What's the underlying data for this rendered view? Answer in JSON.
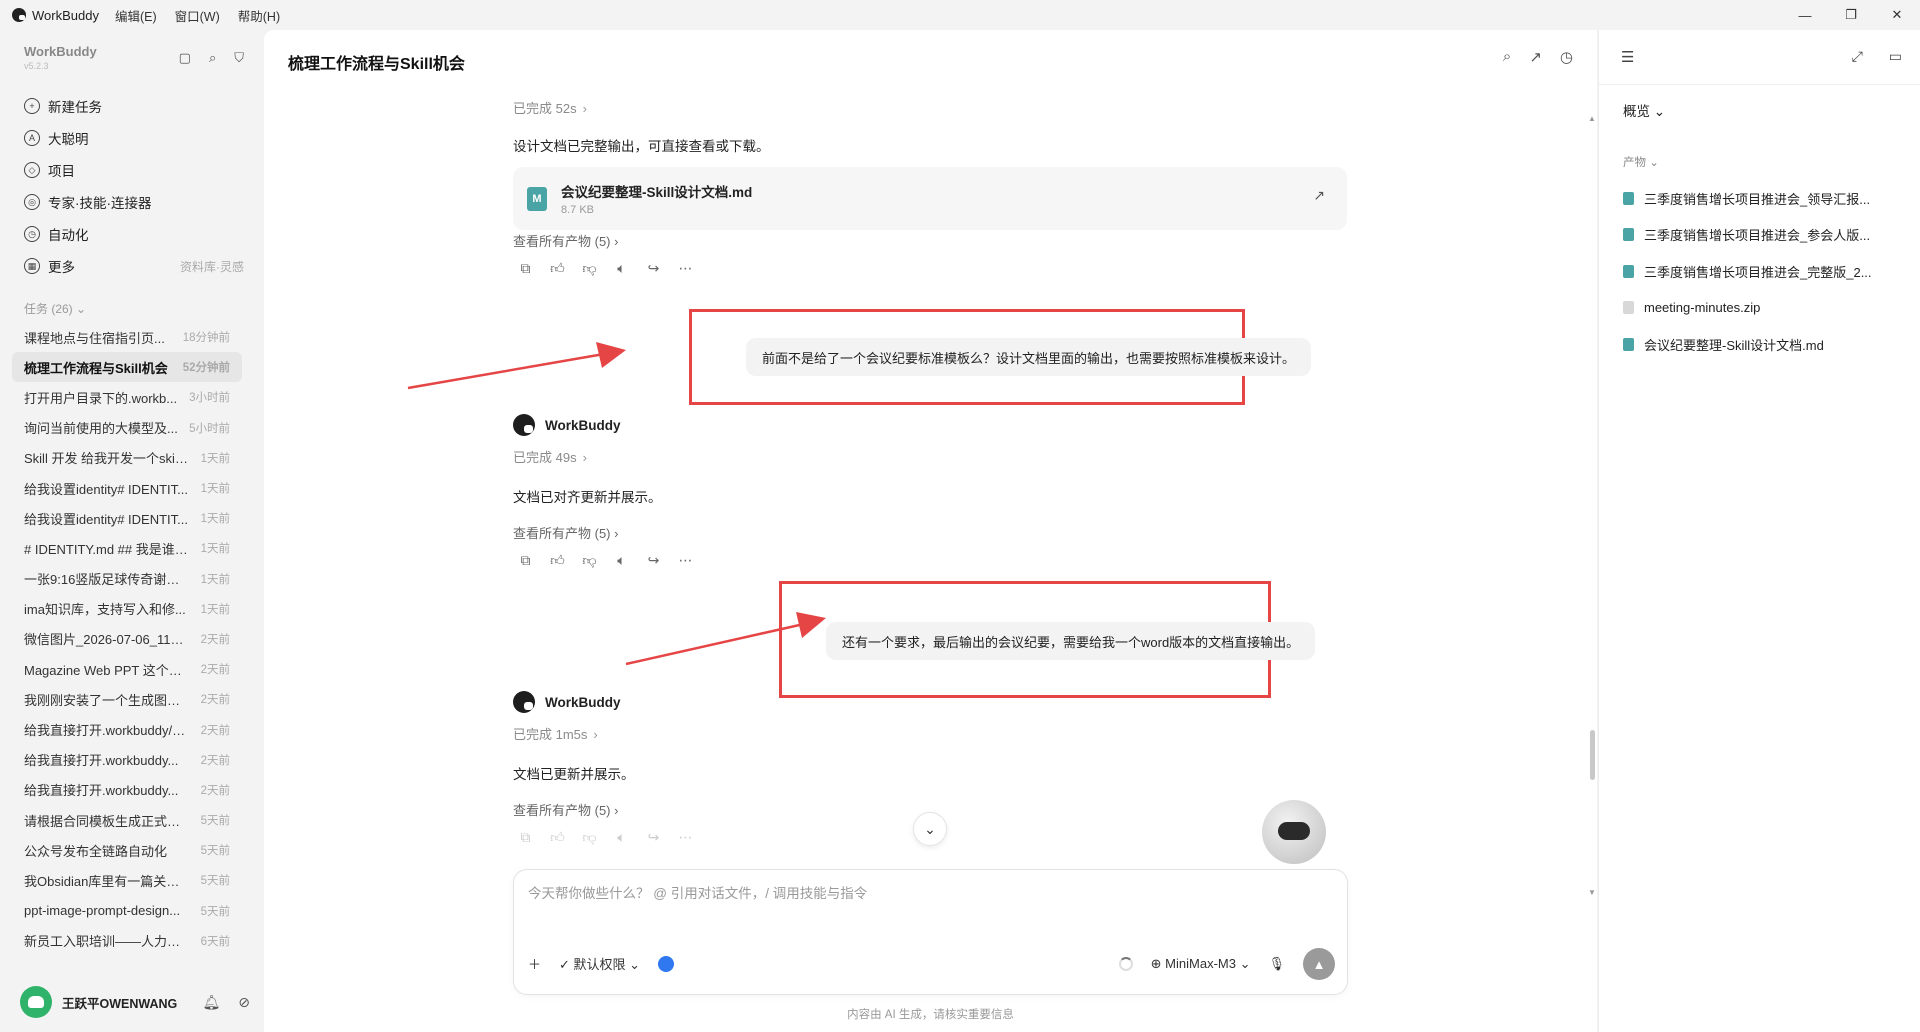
{
  "titlebar": {
    "app_name": "WorkBuddy",
    "menus": [
      "编辑(E)",
      "窗口(W)",
      "帮助(H)"
    ],
    "minimize": "—",
    "maximize": "❐",
    "close": "✕"
  },
  "sidebar": {
    "brand": "WorkBuddy",
    "version": "v5.2.3",
    "nav": [
      {
        "label": "新建任务",
        "icon": "+"
      },
      {
        "label": "大聪明",
        "icon": "A"
      },
      {
        "label": "项目",
        "icon": "◇"
      },
      {
        "label": "专家·技能·连接器",
        "icon": "◎"
      },
      {
        "label": "自动化",
        "icon": "◷"
      },
      {
        "label": "更多",
        "icon": "▦",
        "aside": "资料库·灵感"
      }
    ],
    "tasks_header": "任务 (26) ⌄",
    "tasks": [
      {
        "title": "课程地点与住宿指引页...",
        "time": "18分钟前"
      },
      {
        "title": "梳理工作流程与Skill机会",
        "time": "52分钟前"
      },
      {
        "title": "打开用户目录下的.workb...",
        "time": "3小时前"
      },
      {
        "title": "询问当前使用的大模型及...",
        "time": "5小时前"
      },
      {
        "title": "Skill 开发 给我开发一个skill...",
        "time": "1天前"
      },
      {
        "title": "给我设置identity# IDENTIT...",
        "time": "1天前"
      },
      {
        "title": "给我设置identity# IDENTIT...",
        "time": "1天前"
      },
      {
        "title": "# IDENTITY.md ## 我是谁 ...",
        "time": "1天前"
      },
      {
        "title": "一张9:16竖版足球传奇谢幕...",
        "time": "1天前"
      },
      {
        "title": "ima知识库，支持写入和修...",
        "time": "1天前"
      },
      {
        "title": "微信图片_2026-07-06_1143...",
        "time": "2天前"
      },
      {
        "title": "Magazine Web PPT 这个技...",
        "time": "2天前"
      },
      {
        "title": "我刚刚安装了一个生成图片...",
        "time": "2天前"
      },
      {
        "title": "给我直接打开.workbuddy/s...",
        "time": "2天前"
      },
      {
        "title": "给我直接打开.workbuddy...",
        "time": "2天前"
      },
      {
        "title": "给我直接打开.workbuddy...",
        "time": "2天前"
      },
      {
        "title": "请根据合同模板生成正式合...",
        "time": "5天前"
      },
      {
        "title": "公众号发布全链路自动化",
        "time": "5天前"
      },
      {
        "title": "我Obsidian库里有一篇关于...",
        "time": "5天前"
      },
      {
        "title": "ppt-image-prompt-design...",
        "time": "5天前"
      },
      {
        "title": "新员工入职培训——人力资...",
        "time": "6天前"
      }
    ],
    "user": "王跃平OWENWANG"
  },
  "main": {
    "title": "梳理工作流程与Skill机会",
    "done1": "已完成 52s",
    "para1": "设计文档已完整输出，可直接查看或下载。",
    "file": {
      "icon": "M",
      "name": "会议纪要整理-Skill设计文档.md",
      "size": "8.7 KB"
    },
    "view_all": "查看所有产物 (5)",
    "user_msg1": "前面不是给了一个会议纪要标准模板么？设计文档里面的输出，也需要按照标准模板来设计。",
    "bot_name": "WorkBuddy",
    "done2": "已完成 49s",
    "para2": "文档已对齐更新并展示。",
    "user_msg2": "还有一个要求，最后输出的会议纪要，需要给我一个word版本的文档直接输出。",
    "done3": "已完成 1m5s",
    "para3": "文档已更新并展示。",
    "composer": {
      "placeholder": "今天帮你做些什么？ @ 引用对话文件，/ 调用技能与指令",
      "permission": "默认权限",
      "model": "MiniMax-M3"
    },
    "disclaimer": "内容由 AI 生成，请核实重要信息"
  },
  "rpanel": {
    "overview": "概览",
    "products_label": "产物",
    "files": [
      {
        "name": "三季度销售增长项目推进会_领导汇报...",
        "type": "md"
      },
      {
        "name": "三季度销售增长项目推进会_参会人版...",
        "type": "md"
      },
      {
        "name": "三季度销售增长项目推进会_完整版_2...",
        "type": "md"
      },
      {
        "name": "meeting-minutes.zip",
        "type": "zip"
      },
      {
        "name": "会议纪要整理-Skill设计文档.md",
        "type": "md"
      }
    ]
  },
  "colors": {
    "accent_red": "#e54545",
    "md_file": "#4aa3a5",
    "brand_green": "#2fb36a"
  }
}
